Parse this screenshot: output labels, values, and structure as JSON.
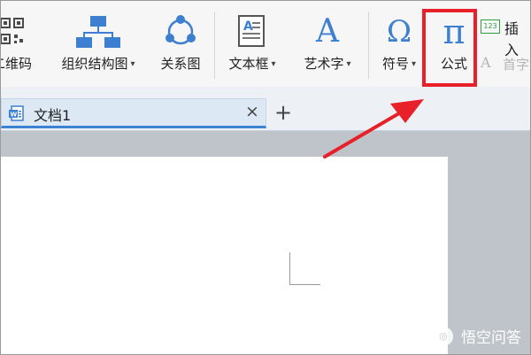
{
  "ribbon": {
    "tools": [
      {
        "id": "qrcode",
        "label": "二维码",
        "icon": "qr-code-icon",
        "dropdown": false
      },
      {
        "id": "org_chart",
        "label": "组织结构图",
        "icon": "org-chart-icon",
        "dropdown": true
      },
      {
        "id": "relation",
        "label": "关系图",
        "icon": "relation-diagram-icon",
        "dropdown": false
      },
      {
        "id": "text_box",
        "label": "文本框",
        "icon": "text-box-icon",
        "dropdown": true
      },
      {
        "id": "word_art",
        "label": "艺术字",
        "icon": "word-art-icon",
        "dropdown": true
      },
      {
        "id": "symbol",
        "label": "符号",
        "icon": "omega-symbol-icon",
        "dropdown": true
      },
      {
        "id": "formula",
        "label": "公式",
        "icon": "pi-formula-icon",
        "dropdown": false
      }
    ],
    "insert_label": "插入",
    "dropcap_label": "首字",
    "formula_glyph": "π",
    "symbol_glyph": "Ω",
    "wordart_glyph": "A",
    "insert_badge": "123",
    "caret": "▾"
  },
  "tabs": [
    {
      "label": "文档1",
      "icon": "word-doc-icon",
      "close": "×"
    }
  ],
  "new_tab": "+",
  "watermark": "悟空问答",
  "colors": {
    "accent": "#3a82d4",
    "highlight": "#e8202a",
    "tab_active": "#dde8f5",
    "workspace": "#bfc4ca"
  }
}
